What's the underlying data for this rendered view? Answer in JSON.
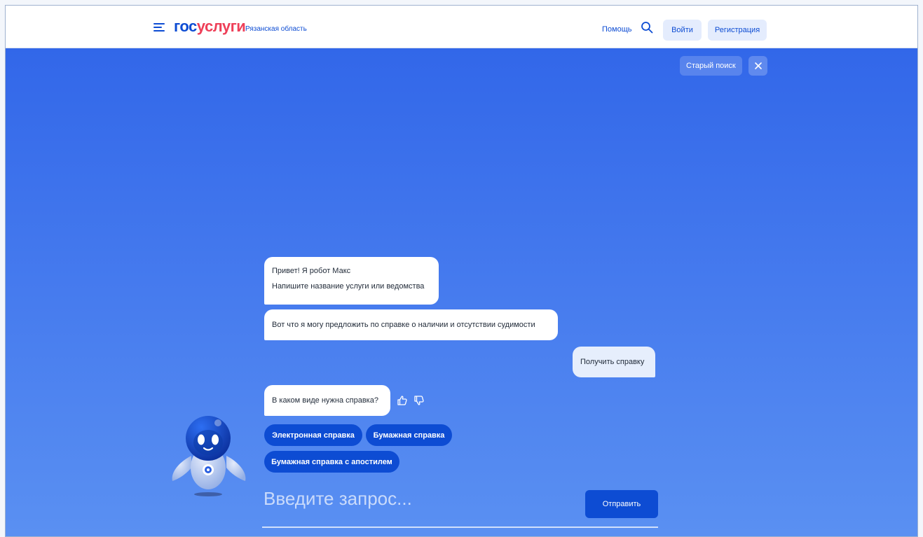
{
  "header": {
    "logo_part1": "гос",
    "logo_part2": "услуги",
    "region": "Рязанская область",
    "help": "Помощь",
    "login": "Войти",
    "register": "Регистрация"
  },
  "top_actions": {
    "old_search": "Старый поиск"
  },
  "chat": {
    "bot_greeting_line1": "Привет! Я робот Макс",
    "bot_greeting_line2": "Напишите название услуги или ведомства",
    "bot_offer": "Вот что я могу предложить по справке о наличии и отсутствии судимости",
    "user_message": "Получить справку",
    "bot_question": "В каком виде нужна справка?",
    "options": [
      "Электронная справка",
      "Бумажная справка",
      "Бумажная справка с апостилем"
    ]
  },
  "input": {
    "placeholder": "Введите запрос...",
    "send_label": "Отправить"
  },
  "colors": {
    "brand_blue": "#0d4cd3",
    "brand_red": "#ee3f58",
    "background_top": "#3267e9",
    "background_bottom": "#5a90f2"
  }
}
